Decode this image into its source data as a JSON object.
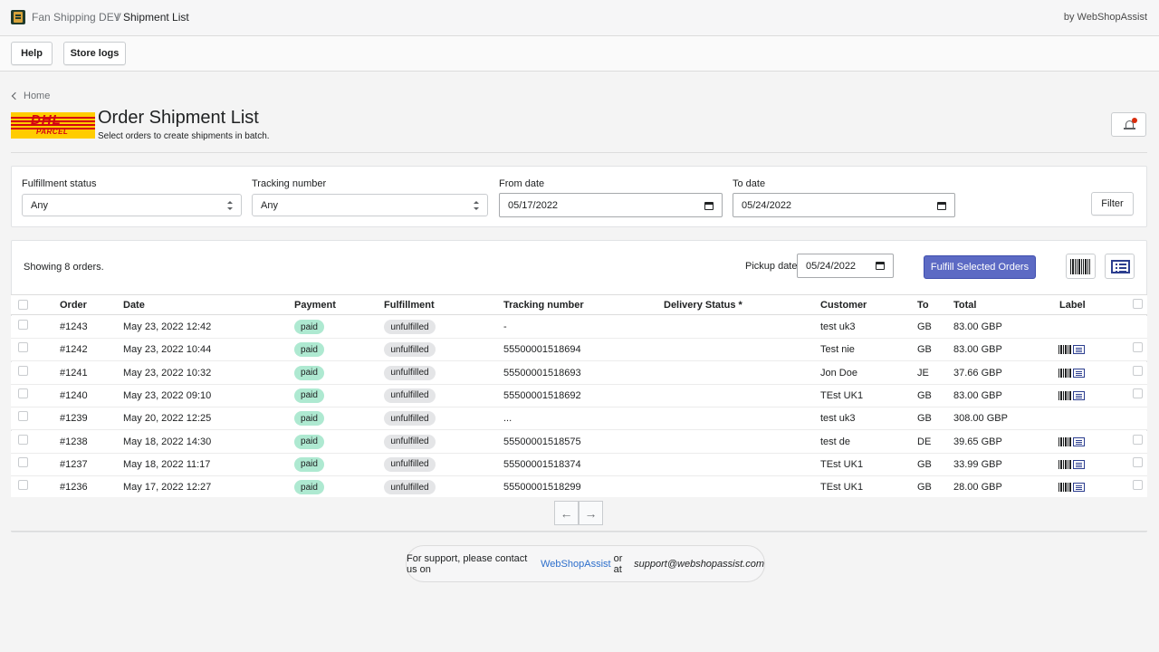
{
  "topbar": {
    "store_name": "Fan Shipping DEV",
    "separator": "/",
    "page_name": "Shipment List",
    "by_text": "by WebShopAssist"
  },
  "toolbar": {
    "help_label": "Help",
    "store_logs_label": "Store logs"
  },
  "header": {
    "back_label": "Home",
    "logo_text": "DHL",
    "logo_subtext": "PARCEL",
    "title": "Order Shipment List",
    "subtitle": "Select orders to create shipments in batch."
  },
  "filters": {
    "fulfillment_status": {
      "label": "Fulfillment status",
      "value": "Any"
    },
    "tracking_number": {
      "label": "Tracking number",
      "value": "Any"
    },
    "from_date": {
      "label": "From date",
      "value": "05/17/2022"
    },
    "to_date": {
      "label": "To date",
      "value": "05/24/2022"
    },
    "filter_button": "Filter"
  },
  "list": {
    "showing_prefix": "Showing",
    "showing_count": "8",
    "showing_suffix": "orders.",
    "pickup_label": "Pickup date:",
    "pickup_value": "05/24/2022",
    "fulfill_button": "Fulfill Selected Orders",
    "columns": [
      "Order",
      "Date",
      "Payment",
      "Fulfillment",
      "Tracking number",
      "Delivery Status *",
      "Customer",
      "To",
      "Total",
      "Label"
    ],
    "rows": [
      {
        "order": "#1243",
        "date": "May 23, 2022 12:42",
        "payment": "paid",
        "fulfillment": "unfulfilled",
        "tracking": "-",
        "tracking_link": false,
        "customer": "test uk3",
        "to": "GB",
        "total": "83.00 GBP",
        "label": false
      },
      {
        "order": "#1242",
        "date": "May 23, 2022 10:44",
        "payment": "paid",
        "fulfillment": "unfulfilled",
        "tracking": "55500001518694",
        "tracking_link": true,
        "customer": "Test nie",
        "to": "GB",
        "total": "83.00 GBP",
        "label": true
      },
      {
        "order": "#1241",
        "date": "May 23, 2022 10:32",
        "payment": "paid",
        "fulfillment": "unfulfilled",
        "tracking": "55500001518693",
        "tracking_link": true,
        "customer": "Jon Doe",
        "to": "JE",
        "total": "37.66 GBP",
        "label": true
      },
      {
        "order": "#1240",
        "date": "May 23, 2022 09:10",
        "payment": "paid",
        "fulfillment": "unfulfilled",
        "tracking": "55500001518692",
        "tracking_link": true,
        "customer": "TEst UK1",
        "to": "GB",
        "total": "83.00 GBP",
        "label": true
      },
      {
        "order": "#1239",
        "date": "May 20, 2022 12:25",
        "payment": "paid",
        "fulfillment": "unfulfilled",
        "tracking": "...",
        "tracking_link": false,
        "customer": "test uk3",
        "to": "GB",
        "total": "308.00 GBP",
        "label": false
      },
      {
        "order": "#1238",
        "date": "May 18, 2022 14:30",
        "payment": "paid",
        "fulfillment": "unfulfilled",
        "tracking": "55500001518575",
        "tracking_link": true,
        "customer": "test de",
        "to": "DE",
        "total": "39.65 GBP",
        "label": true
      },
      {
        "order": "#1237",
        "date": "May 18, 2022 11:17",
        "payment": "paid",
        "fulfillment": "unfulfilled",
        "tracking": "55500001518374",
        "tracking_link": true,
        "customer": "TEst UK1",
        "to": "GB",
        "total": "33.99 GBP",
        "label": true
      },
      {
        "order": "#1236",
        "date": "May 17, 2022 12:27",
        "payment": "paid",
        "fulfillment": "unfulfilled",
        "tracking": "55500001518299",
        "tracking_link": true,
        "customer": "TEst UK1",
        "to": "GB",
        "total": "28.00 GBP",
        "label": true
      }
    ]
  },
  "pagination": {
    "prev_icon": "←",
    "next_icon": "→"
  },
  "footer": {
    "support_text": "For support, please contact us on",
    "support_link": "WebShopAssist",
    "support_or": "or at",
    "support_email": "support@webshopassist.com"
  },
  "colors": {
    "accent": "#5c6ac4",
    "link": "#2c6ecb",
    "paid_badge": "#aee9d1",
    "unfulfilled_badge": "#e4e5e7",
    "dhl_yellow": "#ffcc00",
    "dhl_red": "#d40511"
  }
}
